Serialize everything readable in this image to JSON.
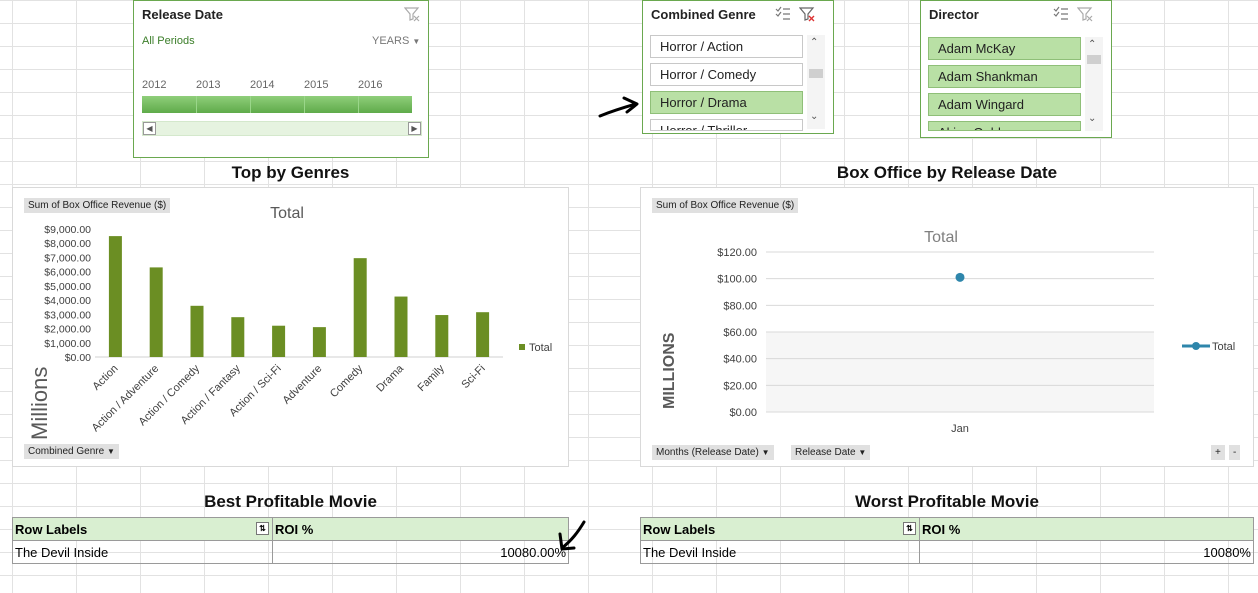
{
  "timeline": {
    "title": "Release Date",
    "periods_label": "All Periods",
    "level_label": "YEARS",
    "years": [
      "2012",
      "2013",
      "2014",
      "2015",
      "2016"
    ]
  },
  "genre_slicer": {
    "title": "Combined Genre",
    "items": [
      {
        "label": "Horror / Action",
        "selected": false
      },
      {
        "label": "Horror / Comedy",
        "selected": false
      },
      {
        "label": "Horror / Drama",
        "selected": true
      },
      {
        "label": "Horror / Thriller",
        "selected": false
      }
    ]
  },
  "director_slicer": {
    "title": "Director",
    "items": [
      {
        "label": "Adam McKay",
        "selected": true
      },
      {
        "label": "Adam Shankman",
        "selected": true
      },
      {
        "label": "Adam Wingard",
        "selected": true
      },
      {
        "label": "Akiva Goldsman",
        "selected": true
      }
    ]
  },
  "genres_chart": {
    "section_title": "Top by Genres",
    "value_field": "Sum of Box Office Revenue ($)",
    "axis_field": "Combined Genre",
    "units_label": "Millions"
  },
  "date_chart": {
    "section_title": "Box Office by Release Date",
    "value_field": "Sum of Box Office Revenue ($)",
    "axis_fields": [
      "Months (Release Date)",
      "Release Date"
    ],
    "units_label": "MILLIONS"
  },
  "chart_data": [
    {
      "type": "bar",
      "title": "Total",
      "categories": [
        "Action",
        "Action / Adventure",
        "Action / Comedy",
        "Action / Fantasy",
        "Action / Sci-Fi",
        "Adventure",
        "Comedy",
        "Drama",
        "Family",
        "Sci-Fi"
      ],
      "series": [
        {
          "name": "Total",
          "values": [
            8500,
            6300,
            3600,
            2800,
            2200,
            2100,
            6950,
            4250,
            2950,
            3150
          ]
        }
      ],
      "ylabel": "Millions",
      "ylim": [
        0,
        9000
      ],
      "yticks": [
        "$0.00",
        "$1,000.00",
        "$2,000.00",
        "$3,000.00",
        "$4,000.00",
        "$5,000.00",
        "$6,000.00",
        "$7,000.00",
        "$8,000.00",
        "$9,000.00"
      ],
      "legend": "right",
      "color": "#6b8e23"
    },
    {
      "type": "line",
      "title": "Total",
      "categories": [
        "Jan"
      ],
      "series": [
        {
          "name": "Total",
          "values": [
            101
          ]
        }
      ],
      "ylabel": "MILLIONS",
      "ylim": [
        0,
        120
      ],
      "yticks": [
        "$0.00",
        "$20.00",
        "$40.00",
        "$60.00",
        "$80.00",
        "$100.00",
        "$120.00"
      ],
      "legend": "right",
      "grid": true,
      "color": "#2e86ab"
    }
  ],
  "best_table": {
    "title": "Best Profitable Movie",
    "col1": "Row Labels",
    "col2": "ROI %",
    "row_label": "The Devil Inside",
    "row_value": "10080.00%"
  },
  "worst_table": {
    "title": "Worst Profitable Movie",
    "col1": "Row Labels",
    "col2": "ROI %",
    "row_label": "The Devil Inside",
    "row_value": "10080%"
  }
}
